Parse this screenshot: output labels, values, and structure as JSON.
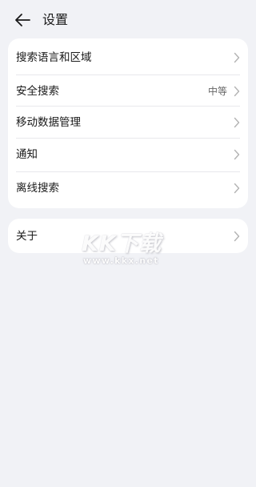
{
  "header": {
    "title": "设置"
  },
  "settings": {
    "items": [
      {
        "label": "搜索语言和区域",
        "value": ""
      },
      {
        "label": "安全搜索",
        "value": "中等"
      },
      {
        "label": "移动数据管理",
        "value": ""
      },
      {
        "label": "通知",
        "value": ""
      },
      {
        "label": "离线搜索",
        "value": ""
      }
    ]
  },
  "about": {
    "label": "关于"
  },
  "watermark": {
    "logo": "KK下载",
    "url": "www.kkx.net"
  },
  "colors": {
    "background": "#f1f2f6",
    "card": "#ffffff",
    "text_primary": "#1a1a1a",
    "text_secondary": "#666666",
    "chevron": "#b3b3b3"
  },
  "icons": {
    "back": "arrow-left-icon",
    "row": "chevron-right-icon"
  }
}
